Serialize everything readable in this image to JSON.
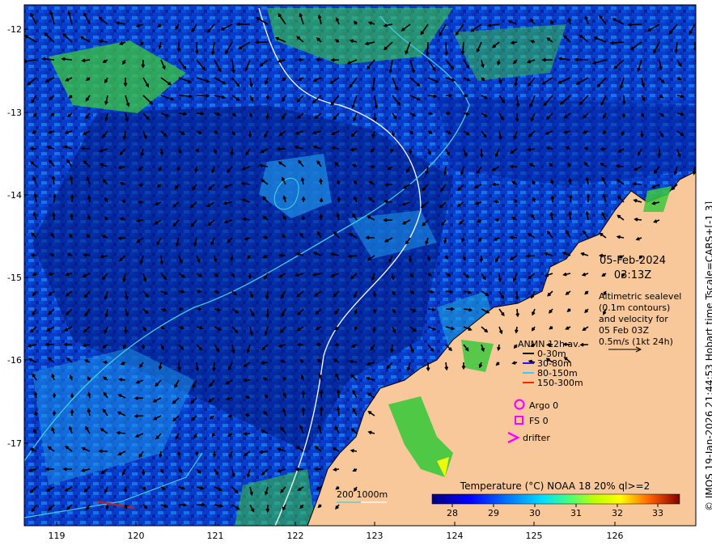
{
  "map": {
    "date": "05-Feb-2024",
    "time": "03:13Z",
    "description_lines": [
      "Altimetric sealevel",
      "(0.1m contours)",
      "and velocity for",
      "05 Feb 03Z",
      "0.5m/s (1kt 24h)"
    ],
    "x_ticks": [
      "119",
      "120",
      "121",
      "122",
      "123",
      "124",
      "125",
      "126"
    ],
    "y_ticks": [
      "-12",
      "-13",
      "-14",
      "-15",
      "-16",
      "-17"
    ],
    "credit": "© IMOS 19-Jan-2026 21:44:53 Hobart time Tscale=CARS+[-1 3]",
    "bathy_label": "200  1000m",
    "bathy_colors": [
      "#44ccdd",
      "#ffffff"
    ]
  },
  "legend": {
    "title": "ANMN 12h av.",
    "items": [
      {
        "label": "0-30m",
        "color": "#000000"
      },
      {
        "label": "30-80m",
        "color": "#1a1aff"
      },
      {
        "label": "80-150m",
        "color": "#33ccff"
      },
      {
        "label": "150-300m",
        "color": "#ff2200"
      }
    ],
    "argo": "Argo 0",
    "fs": "FS 0",
    "drifter": "drifter",
    "marker_color": "#ff00ff"
  },
  "colorbar": {
    "title": "Temperature (°C) NOAA 18 20% ql>=2",
    "ticks": [
      "28",
      "29",
      "30",
      "31",
      "32",
      "33"
    ]
  },
  "colors": {
    "land": "#f9c89a",
    "ocean_deep": "#001a80",
    "ocean_mid": "#0055d4",
    "ocean_light": "#1e90e6",
    "warm": "#3cc83c"
  }
}
